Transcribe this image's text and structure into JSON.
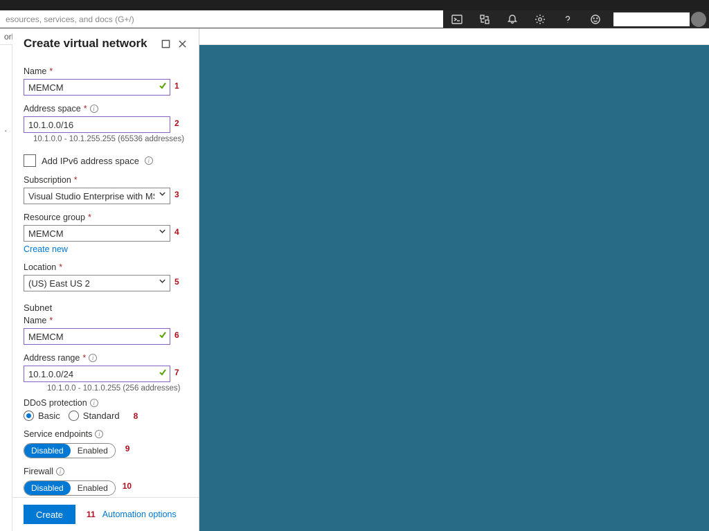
{
  "topbar": {
    "search_placeholder": "esources, services, and docs (G+/)",
    "crumb": "ork"
  },
  "blade": {
    "title": "Create virtual network"
  },
  "annotations": {
    "a1": "1",
    "a2": "2",
    "a3": "3",
    "a4": "4",
    "a5": "5",
    "a6": "6",
    "a7": "7",
    "a8": "8",
    "a9": "9",
    "a10": "10",
    "a11": "11"
  },
  "name": {
    "label": "Name",
    "value": "MEMCM"
  },
  "address_space": {
    "label": "Address space",
    "value": "10.1.0.0/16",
    "hint": "10.1.0.0 - 10.1.255.255 (65536 addresses)"
  },
  "ipv6": {
    "label": "Add IPv6 address space"
  },
  "subscription": {
    "label": "Subscription",
    "value": "Visual Studio Enterprise with MSDN"
  },
  "resource_group": {
    "label": "Resource group",
    "value": "MEMCM",
    "create_new": "Create new"
  },
  "location": {
    "label": "Location",
    "value": "(US) East US 2"
  },
  "subnet": {
    "section": "Subnet",
    "name_label": "Name",
    "name_value": "MEMCM",
    "range_label": "Address range",
    "range_value": "10.1.0.0/24",
    "range_hint": "10.1.0.0 - 10.1.0.255 (256 addresses)"
  },
  "ddos": {
    "label": "DDoS protection",
    "basic": "Basic",
    "standard": "Standard"
  },
  "service_endpoints": {
    "label": "Service endpoints",
    "disabled": "Disabled",
    "enabled": "Enabled"
  },
  "firewall": {
    "label": "Firewall",
    "disabled": "Disabled",
    "enabled": "Enabled"
  },
  "footer": {
    "create": "Create",
    "automation": "Automation options"
  }
}
